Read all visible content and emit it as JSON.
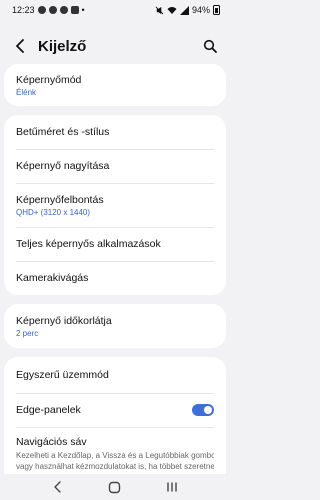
{
  "status_bar": {
    "time": "12:23",
    "battery": "94%"
  },
  "header": {
    "title": "Kijelző"
  },
  "cards": {
    "mode": {
      "title": "Képernyőmód",
      "value": "Élénk"
    },
    "font": {
      "title": "Betűméret és -stílus"
    },
    "zoom": {
      "title": "Képernyő nagyítása"
    },
    "resolution": {
      "title": "Képernyőfelbontás",
      "value": "QHD+ (3120 x 1440)"
    },
    "fullscreen": {
      "title": "Teljes képernyős alkalmazások"
    },
    "cutout": {
      "title": "Kameraki­vágás"
    },
    "timeout": {
      "title": "Képernyő időkorlátja",
      "value": "2 perc"
    },
    "easy": {
      "title": "Egyszerű üzemmód"
    },
    "edge": {
      "title": "Edge-panelek",
      "enabled": true
    },
    "navbar": {
      "title": "Navigációs sáv",
      "desc_line1": "Kezelheti a Kezdőlap, a Vissza és a Legutóbbiak gombot,",
      "desc_line2": "vagy használhat kézmozdulatokat is, ha többet szeretne"
    }
  },
  "accent_color": "#3e6fd8",
  "icons": {
    "back": "back-arrow-icon",
    "search": "search-icon",
    "nav_recents": "recents-icon",
    "nav_home": "home-icon",
    "nav_back": "back-icon"
  }
}
